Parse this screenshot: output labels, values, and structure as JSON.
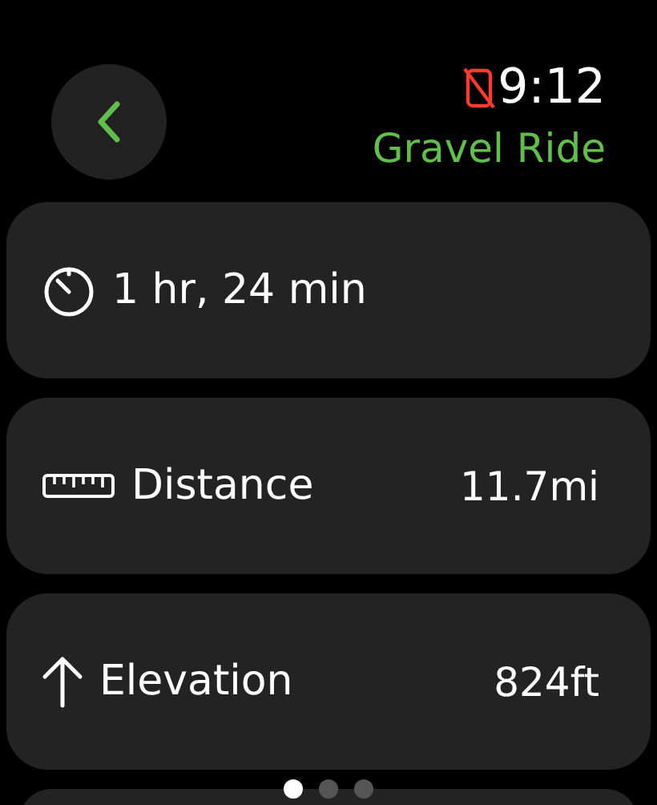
{
  "status": {
    "time": "9:12",
    "phone_disconnected": true
  },
  "title": "Gravel Ride",
  "metrics": [
    {
      "kind": "duration",
      "value": "1 hr, 24 min"
    },
    {
      "kind": "distance",
      "label": "Distance",
      "value": "11.7mi"
    },
    {
      "kind": "elevation",
      "label": "Elevation",
      "value": "824ft"
    }
  ],
  "pages": [
    {
      "selected": true
    },
    {
      "selected": false
    },
    {
      "selected": false
    }
  ]
}
